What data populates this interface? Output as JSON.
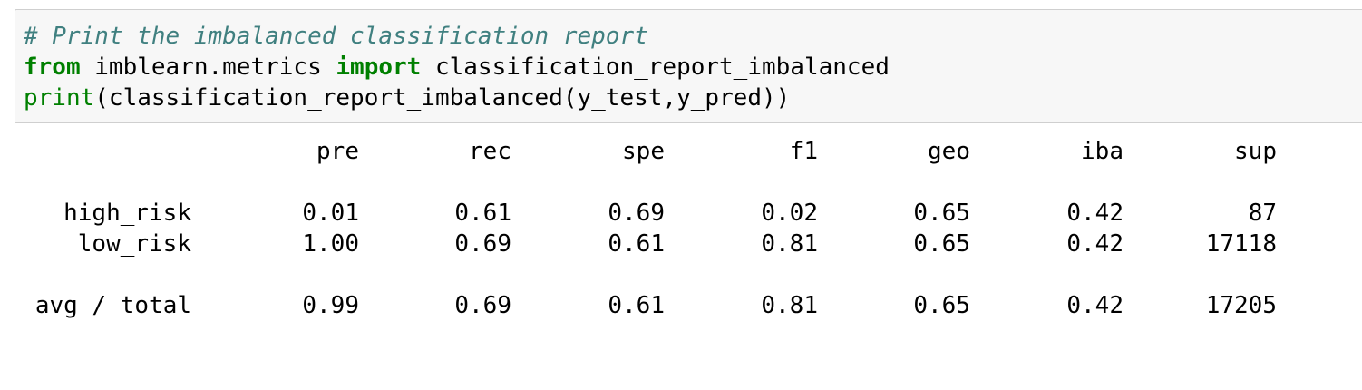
{
  "code_cell": {
    "line1_comment": "# Print the imbalanced classification report",
    "line2_kw_from": "from",
    "line2_module": " imblearn.metrics ",
    "line2_kw_import": "import",
    "line2_name": " classification_report_imbalanced",
    "line3_builtin": "print",
    "line3_rest": "(classification_report_imbalanced(y_test,y_pred))"
  },
  "report": {
    "headers": [
      "pre",
      "rec",
      "spe",
      "f1",
      "geo",
      "iba",
      "sup"
    ],
    "rows": [
      {
        "label": "high_risk",
        "values": [
          "0.01",
          "0.61",
          "0.69",
          "0.02",
          "0.65",
          "0.42",
          "87"
        ]
      },
      {
        "label": "low_risk",
        "values": [
          "1.00",
          "0.69",
          "0.61",
          "0.81",
          "0.65",
          "0.42",
          "17118"
        ]
      }
    ],
    "total": {
      "label": "avg / total",
      "values": [
        "0.99",
        "0.69",
        "0.61",
        "0.81",
        "0.65",
        "0.42",
        "17205"
      ]
    }
  },
  "colors": {
    "comment": "#408080",
    "keyword": "#008000",
    "cell_background": "#f7f7f7",
    "cell_border": "#cfcfcf"
  }
}
